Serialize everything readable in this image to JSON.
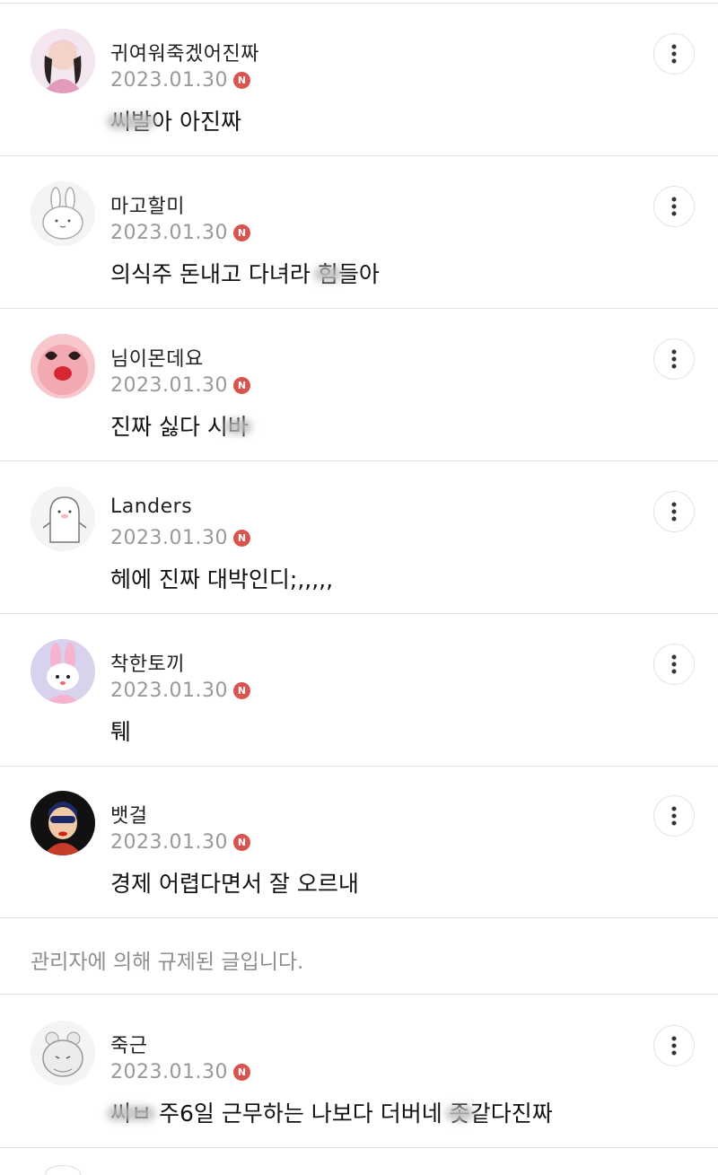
{
  "comments": [
    {
      "name": "귀여워죽겠어진짜",
      "date": "2023.01.30",
      "badge": "N",
      "text_blurred": "씨발",
      "text": "아 아진짜"
    },
    {
      "name": "마고할미",
      "date": "2023.01.30",
      "badge": "N",
      "text": "의식주 돈내고 다녀라 ",
      "text_blurred": "힘",
      "text_after": "들아"
    },
    {
      "name": "님이몬데요",
      "date": "2023.01.30",
      "badge": "N",
      "text": "진짜 싫다 시",
      "text_blurred": "바"
    },
    {
      "name": "Landers",
      "date": "2023.01.30",
      "badge": "N",
      "text": "헤에 진짜 대박인디;,,,,,"
    },
    {
      "name": "착한토끼",
      "date": "2023.01.30",
      "badge": "N",
      "text": "퉤"
    },
    {
      "name": "뱃걸",
      "date": "2023.01.30",
      "badge": "N",
      "text": "경제 어렵다면서 잘 오르내"
    },
    {
      "name": "죽근",
      "date": "2023.01.30",
      "badge": "N",
      "text_blurred": "씨ㅂ",
      "text": " 주6일 근무하는 나보다 더버네 ",
      "text_blurred2": "좃",
      "text_after": "같다진짜"
    }
  ],
  "notice": "관리자에 의해 규제된 글입니다.",
  "icons": {
    "more": "more-vertical-icon",
    "badge": "new-badge-icon"
  },
  "colors": {
    "badge": "#d9534f",
    "date": "#999999",
    "notice": "#8e8e8e"
  }
}
